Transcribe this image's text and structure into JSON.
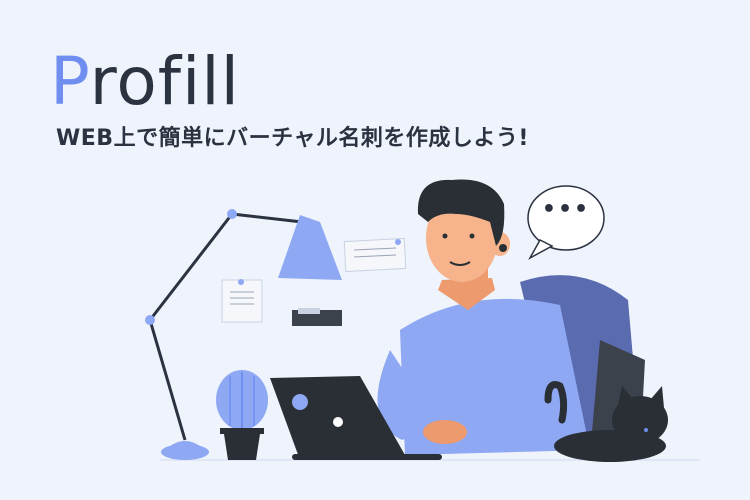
{
  "brand": {
    "logo_initial": "P",
    "logo_rest": "rofill",
    "tagline": "WEB上で簡単にバーチャル名刺を作成しよう!"
  },
  "illustration": {
    "speech_bubble_text": "•••"
  },
  "colors": {
    "background": "#eef3fc",
    "accent": "#6f8ef0",
    "text": "#2c3340",
    "shirt": "#8ea8f3",
    "laptop": "#2a2f36"
  }
}
